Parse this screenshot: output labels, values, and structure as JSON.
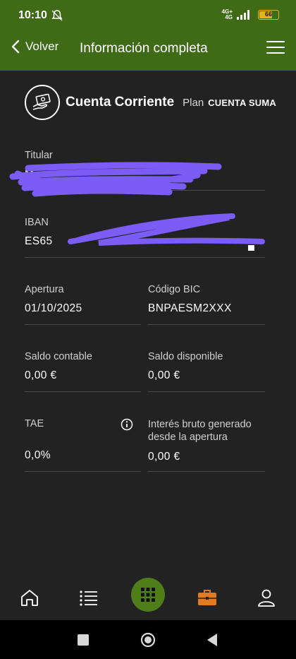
{
  "status_bar": {
    "time": "10:10",
    "network": "4G+",
    "network_sub": "4G",
    "battery": "66",
    "battery_color": "#e1b21c"
  },
  "header": {
    "back_label": "Volver",
    "title": "Información completa",
    "color": "#3f6b17"
  },
  "account": {
    "icon": "money-bill-hand-icon",
    "name": "Cuenta Corriente",
    "plan_label": "Plan",
    "plan_name": "CUENTA SUMA"
  },
  "fields": {
    "titular": {
      "label": "Titular",
      "value": "M"
    },
    "iban": {
      "label": "IBAN",
      "value": "ES65"
    },
    "apertura": {
      "label": "Apertura",
      "value": "01/10/2025"
    },
    "bic": {
      "label": "Código BIC",
      "value": "BNPAESM2XXX"
    },
    "saldo_contable": {
      "label": "Saldo contable",
      "value": "0,00 €"
    },
    "saldo_disponible": {
      "label": "Saldo disponible",
      "value": "0,00 €"
    },
    "tae": {
      "label": "TAE",
      "value": "0,0%"
    },
    "interes": {
      "label": "Interés bruto generado desde la apertura",
      "value": "0,00 €"
    }
  },
  "bottom_nav": {
    "items": [
      "home-icon",
      "list-icon",
      "grid-icon",
      "briefcase-icon",
      "user-icon"
    ],
    "active": "briefcase-icon",
    "active_color": "#e07b22",
    "center_color": "#4f7d19"
  },
  "redaction_color": "#7b5cf5"
}
